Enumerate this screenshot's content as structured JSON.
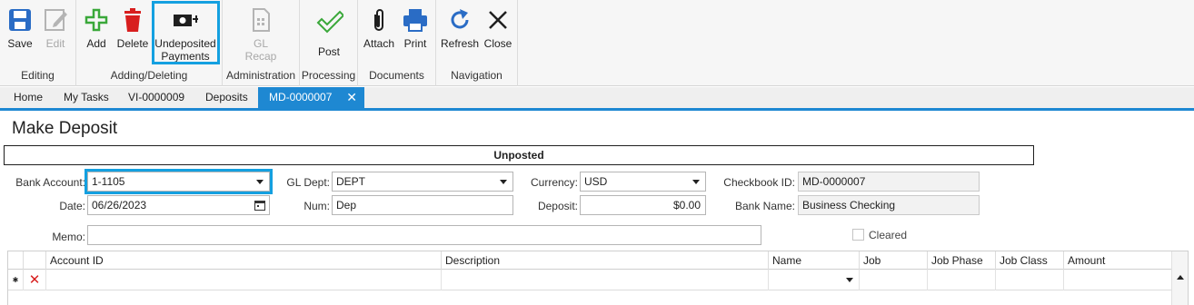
{
  "ribbon": {
    "editing": {
      "label": "Editing",
      "save": "Save",
      "edit": "Edit"
    },
    "adding": {
      "label": "Adding/Deleting",
      "add": "Add",
      "delete": "Delete",
      "undeposited_line1": "Undeposited",
      "undeposited_line2": "Payments"
    },
    "administration": {
      "label": "Administration",
      "gl_line1": "GL",
      "gl_line2": "Recap"
    },
    "processing": {
      "label": "Processing",
      "post": "Post"
    },
    "documents": {
      "label": "Documents",
      "attach": "Attach",
      "print": "Print"
    },
    "navigation": {
      "label": "Navigation",
      "refresh": "Refresh",
      "close": "Close"
    }
  },
  "tabs": [
    "Home",
    "My Tasks",
    "VI-0000009",
    "Deposits",
    "MD-0000007"
  ],
  "tab_close": "✕",
  "form": {
    "title": "Make Deposit",
    "status": "Unposted",
    "bank_account": {
      "label": "Bank Account:",
      "value": "1-1105"
    },
    "gl_dept": {
      "label": "GL Dept:",
      "value": "DEPT"
    },
    "currency": {
      "label": "Currency:",
      "value": "USD"
    },
    "checkbook_id": {
      "label": "Checkbook ID:",
      "value": "MD-0000007"
    },
    "date": {
      "label": "Date:",
      "value": "06/26/2023"
    },
    "num": {
      "label": "Num:",
      "value": "Dep"
    },
    "deposit": {
      "label": "Deposit:",
      "value": "$0.00"
    },
    "bank_name": {
      "label": "Bank Name:",
      "value": "Business Checking"
    },
    "memo": {
      "label": "Memo:",
      "value": ""
    },
    "cleared": {
      "label": "Cleared",
      "checked": false
    }
  },
  "grid": {
    "columns": [
      "Account ID",
      "Description",
      "Name",
      "Job",
      "Job Phase",
      "Job Class",
      "Amount"
    ],
    "new_row_marker": "✱",
    "delete_glyph": "✕"
  },
  "colors": {
    "accent": "#1e88d2",
    "highlight": "#14a0e0",
    "save_icon": "#2a6cc5",
    "add_icon": "#3aa83a",
    "delete_icon": "#d81e1e",
    "print_icon": "#2a6cc5",
    "post_icon": "#3aa83a"
  }
}
